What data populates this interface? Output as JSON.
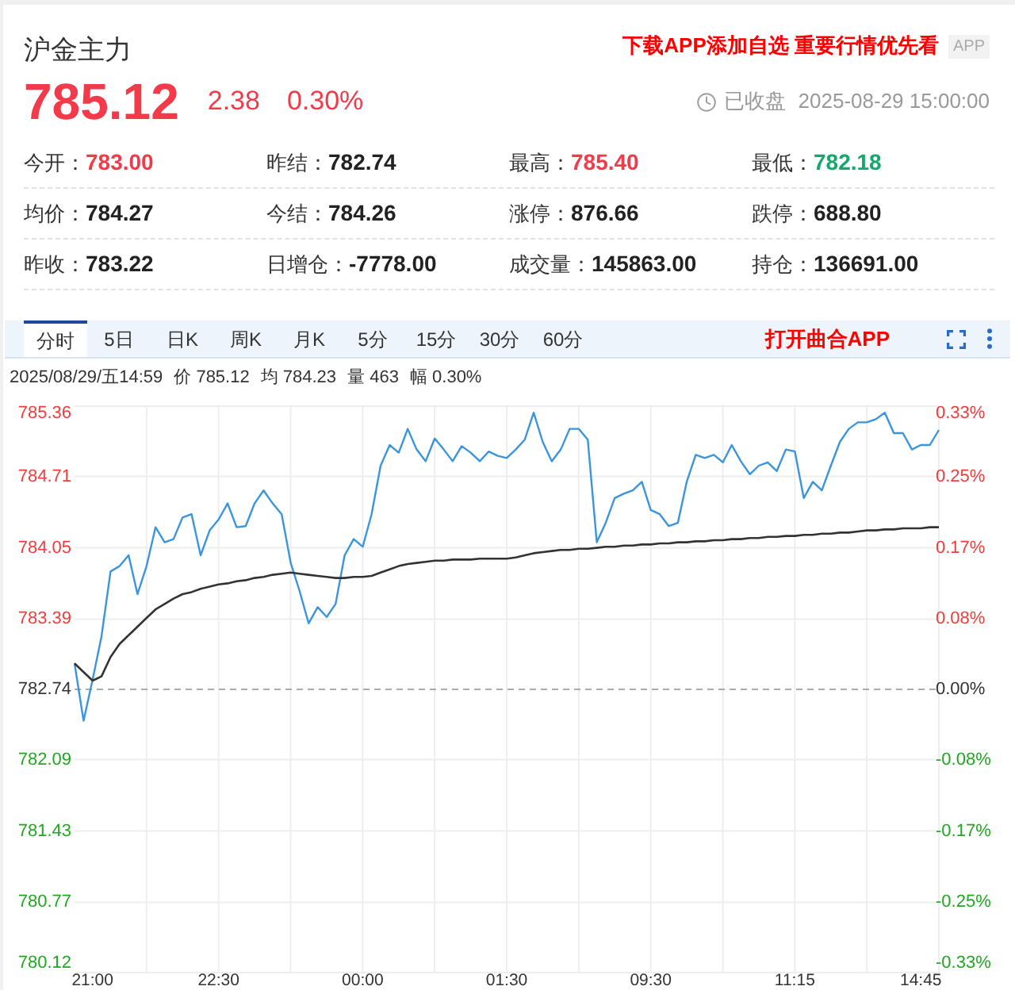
{
  "header": {
    "title": "沪金主力",
    "promo": "下载APP添加自选 重要行情优先看",
    "app_badge": "APP",
    "price": "785.12",
    "change": "2.38",
    "change_percent": "0.30%",
    "status": "已收盘",
    "timestamp": "2025-08-29 15:00:00"
  },
  "stat_rows": [
    [
      {
        "label": "今开：",
        "value": "783.00",
        "color": "#f23a4a"
      },
      {
        "label": "昨结：",
        "value": "782.74",
        "color": "#222222"
      },
      {
        "label": "最高：",
        "value": "785.40",
        "color": "#f23a4a"
      },
      {
        "label": "最低：",
        "value": "782.18",
        "color": "#14a86b"
      }
    ],
    [
      {
        "label": "均价：",
        "value": "784.27",
        "color": "#222222"
      },
      {
        "label": "今结：",
        "value": "784.26",
        "color": "#222222"
      },
      {
        "label": "涨停：",
        "value": "876.66",
        "color": "#222222"
      },
      {
        "label": "跌停：",
        "value": "688.80",
        "color": "#222222"
      }
    ],
    [
      {
        "label": "昨收：",
        "value": "783.22",
        "color": "#222222"
      },
      {
        "label": "日增仓：",
        "value": "-7778.00",
        "color": "#222222"
      },
      {
        "label": "成交量：",
        "value": "145863.00",
        "color": "#222222"
      },
      {
        "label": "持仓：",
        "value": "136691.00",
        "color": "#222222"
      }
    ]
  ],
  "chart_toolbar": {
    "tabs": [
      {
        "label": "分时",
        "selected": true
      },
      {
        "label": "5日",
        "selected": false
      },
      {
        "label": "日K",
        "selected": false
      },
      {
        "label": "周K",
        "selected": false
      },
      {
        "label": "月K",
        "selected": false
      },
      {
        "label": "5分",
        "selected": false
      },
      {
        "label": "15分",
        "selected": false
      },
      {
        "label": "30分",
        "selected": false
      },
      {
        "label": "60分",
        "selected": false
      }
    ],
    "open_app_link": "打开曲合APP"
  },
  "info_line": {
    "time": "2025/08/29/五14:59",
    "items": [
      "价 785.12",
      "均 784.23",
      "量 463",
      "幅 0.30%"
    ]
  },
  "chart": {
    "chart_data": {
      "type": "line",
      "grid": true,
      "categories": [
        null,
        null,
        "21:00",
        null,
        null,
        null,
        null,
        null,
        null,
        null,
        null,
        null,
        null,
        null,
        null,
        null,
        "22:30",
        null,
        null,
        null,
        null,
        null,
        null,
        null,
        null,
        null,
        null,
        null,
        null,
        null,
        null,
        null,
        "00:00",
        null,
        null,
        null,
        null,
        null,
        null,
        null,
        null,
        null,
        null,
        null,
        null,
        null,
        null,
        null,
        "01:30",
        null,
        null,
        null,
        null,
        null,
        null,
        null,
        null,
        null,
        null,
        null,
        null,
        null,
        null,
        null,
        "09:30",
        null,
        null,
        null,
        null,
        null,
        null,
        null,
        null,
        null,
        null,
        null,
        null,
        null,
        null,
        null,
        "11:15",
        null,
        null,
        null,
        null,
        null,
        null,
        null,
        null,
        null,
        null,
        null,
        null,
        null,
        "14:45",
        null,
        null
      ],
      "ylim": [
        780.12,
        785.36
      ],
      "yticks": [
        785.36,
        784.71,
        784.05,
        783.39,
        782.74,
        782.09,
        781.43,
        780.77,
        780.12
      ],
      "series": [
        {
          "color": "#3a95dd",
          "values": [
            782.98,
            782.45,
            782.83,
            783.23,
            783.83,
            783.88,
            783.98,
            783.62,
            783.88,
            784.24,
            784.1,
            784.13,
            784.33,
            784.36,
            783.98,
            784.21,
            784.31,
            784.46,
            784.24,
            784.25,
            784.46,
            784.58,
            784.46,
            784.36,
            783.91,
            783.65,
            783.35,
            783.5,
            783.41,
            783.53,
            783.98,
            784.13,
            784.06,
            784.36,
            784.81,
            785.0,
            784.93,
            785.15,
            784.96,
            784.85,
            785.06,
            784.96,
            784.85,
            784.99,
            784.93,
            784.85,
            784.94,
            784.9,
            784.88,
            784.96,
            785.05,
            785.3,
            785.03,
            784.85,
            784.96,
            785.15,
            785.15,
            785.05,
            784.1,
            784.28,
            784.51,
            784.55,
            784.58,
            784.66,
            784.4,
            784.36,
            784.25,
            784.28,
            784.66,
            784.91,
            784.88,
            784.91,
            784.84,
            785.0,
            784.85,
            784.73,
            784.81,
            784.84,
            784.76,
            784.96,
            784.94,
            784.51,
            784.66,
            784.58,
            784.81,
            785.03,
            785.15,
            785.21,
            785.21,
            785.24,
            785.3,
            785.11,
            785.11,
            784.96,
            785.0,
            785.0,
            785.14
          ]
        },
        {
          "color": "#333333",
          "values": [
            782.98,
            782.9,
            782.82,
            782.86,
            783.04,
            783.16,
            783.24,
            783.32,
            783.4,
            783.48,
            783.53,
            783.58,
            783.62,
            783.64,
            783.67,
            783.69,
            783.71,
            783.72,
            783.74,
            783.75,
            783.77,
            783.78,
            783.8,
            783.81,
            783.82,
            783.81,
            783.8,
            783.79,
            783.78,
            783.77,
            783.77,
            783.78,
            783.78,
            783.79,
            783.82,
            783.85,
            783.88,
            783.9,
            783.91,
            783.92,
            783.93,
            783.93,
            783.94,
            783.94,
            783.94,
            783.95,
            783.95,
            783.95,
            783.95,
            783.96,
            783.98,
            784.0,
            784.01,
            784.02,
            784.03,
            784.03,
            784.04,
            784.04,
            784.05,
            784.06,
            784.06,
            784.07,
            784.07,
            784.08,
            784.08,
            784.09,
            784.09,
            784.1,
            784.1,
            784.11,
            784.11,
            784.12,
            784.12,
            784.13,
            784.13,
            784.14,
            784.14,
            784.15,
            784.15,
            784.16,
            784.16,
            784.17,
            784.17,
            784.18,
            784.18,
            784.19,
            784.19,
            784.2,
            784.21,
            784.21,
            784.22,
            784.22,
            784.23,
            784.23,
            784.23,
            784.24,
            784.24
          ]
        }
      ],
      "ref_lines": [
        {
          "axis": "y",
          "value": 782.74
        }
      ]
    },
    "percent_labels": [
      "0.33%",
      "0.25%",
      "0.17%",
      "0.08%",
      "0.00%",
      "-0.08%",
      "-0.17%",
      "-0.25%",
      "-0.33%"
    ]
  }
}
